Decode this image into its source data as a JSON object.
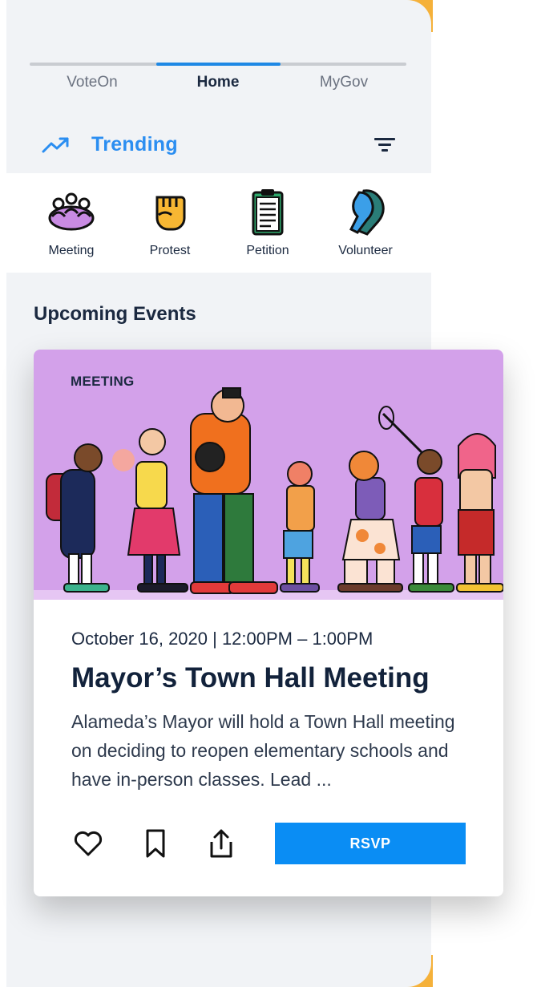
{
  "tabs": [
    {
      "label": "VoteOn",
      "active": false
    },
    {
      "label": "Home",
      "active": true
    },
    {
      "label": "MyGov",
      "active": false
    }
  ],
  "trending": {
    "label": "Trending",
    "icon": "trending-up-icon",
    "filter_icon": "filter-icon",
    "accent": "#2b8ef1"
  },
  "categories": [
    {
      "label": "Meeting",
      "icon": "meeting-icon"
    },
    {
      "label": "Protest",
      "icon": "protest-fist-icon"
    },
    {
      "label": "Petition",
      "icon": "petition-clipboard-icon"
    },
    {
      "label": "Volunteer",
      "icon": "volunteer-hand-icon"
    }
  ],
  "section": {
    "title": "Upcoming Events"
  },
  "event": {
    "tag": "MEETING",
    "datetime": "October 16, 2020 | 12:00PM – 1:00PM",
    "title": "Mayor’s Town Hall Meeting",
    "description": "Alameda’s Mayor will hold a Town Hall meeting on deciding to reopen elementary schools and have in-person classes. Lead ...",
    "rsvp_label": "RSVP",
    "actions": [
      "heart-icon",
      "bookmark-icon",
      "share-icon"
    ]
  },
  "colors": {
    "accent": "#0a8df4",
    "hero_bg": "#d3a1ea",
    "brand_gold": "#f5b13a",
    "text_dark": "#1b2940"
  }
}
